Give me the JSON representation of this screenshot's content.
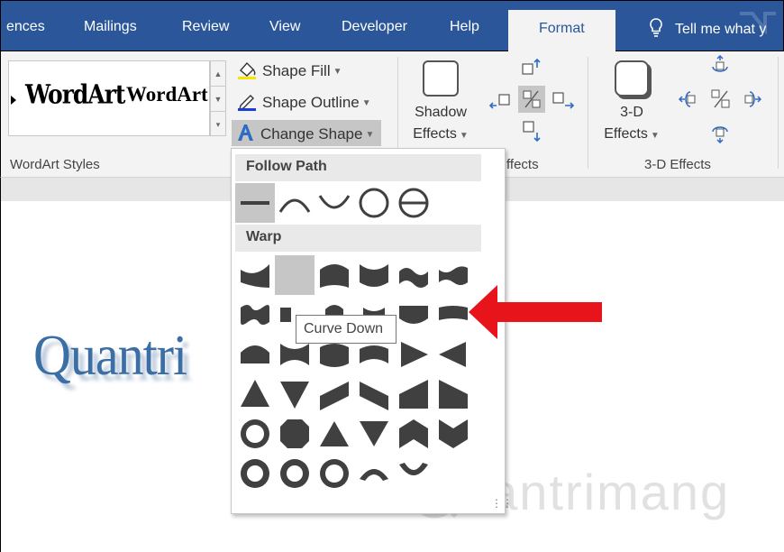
{
  "tabs": [
    {
      "label": "ences"
    },
    {
      "label": "Mailings"
    },
    {
      "label": "Review"
    },
    {
      "label": "View"
    },
    {
      "label": "Developer"
    },
    {
      "label": "Help"
    },
    {
      "label": "Format",
      "active": true
    }
  ],
  "tell_me": "Tell me what y",
  "wordart_styles": {
    "sample1": "WordArt",
    "sample2": "WordArt",
    "group_label": "WordArt Styles"
  },
  "text_fill": "Shape Fill",
  "text_outline": "Shape Outline",
  "change_shape": "Change Shape",
  "shadow_effects": {
    "line1": "Shadow",
    "line2": "Effects"
  },
  "shadow_group_label": "ffects",
  "three_d": {
    "line1": "3-D",
    "line2": "Effects",
    "group_label": "3-D Effects"
  },
  "menu": {
    "follow_path_header": "Follow Path",
    "warp_header": "Warp",
    "tooltip": "Curve Down"
  },
  "document_text": "Quantri",
  "watermark": "uantrimang",
  "colors": {
    "ribbon_blue": "#2b579a",
    "ribbon_bg": "#f3f3f3",
    "shape_gray": "#404040",
    "arrow_red": "#e8141c",
    "wordart_blue": "#3a6ea5"
  }
}
